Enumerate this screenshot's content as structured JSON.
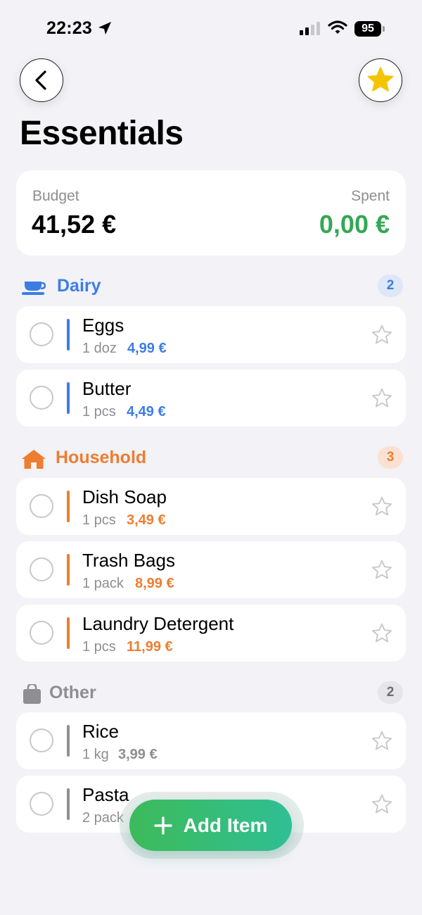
{
  "status_bar": {
    "time": "22:23",
    "battery": "95"
  },
  "header": {
    "title": "Essentials"
  },
  "budget": {
    "budget_label": "Budget",
    "budget_value": "41,52 €",
    "spent_label": "Spent",
    "spent_value": "0,00 €"
  },
  "colors": {
    "dairy": "#3d7de3",
    "household": "#ee7d2f",
    "other": "#8e8e93",
    "spent": "#34a853",
    "accent_gradient": [
      "#3dba5a",
      "#2fbf94"
    ]
  },
  "sections": [
    {
      "title": "Dairy",
      "count": "2",
      "icon": "cup-icon",
      "items": [
        {
          "name": "Eggs",
          "qty": "1 doz",
          "price": "4,99 €"
        },
        {
          "name": "Butter",
          "qty": "1 pcs",
          "price": "4,49 €"
        }
      ]
    },
    {
      "title": "Household",
      "count": "3",
      "icon": "house-icon",
      "items": [
        {
          "name": "Dish Soap",
          "qty": "1 pcs",
          "price": "3,49 €"
        },
        {
          "name": "Trash Bags",
          "qty": "1 pack",
          "price": "8,99 €"
        },
        {
          "name": "Laundry Detergent",
          "qty": "1 pcs",
          "price": "11,99 €"
        }
      ]
    },
    {
      "title": "Other",
      "count": "2",
      "icon": "bag-icon",
      "items": [
        {
          "name": "Rice",
          "qty": "1 kg",
          "price": "3,99 €"
        },
        {
          "name": "Pasta",
          "qty": "2 pack",
          "price": ""
        }
      ]
    }
  ],
  "add_button": {
    "label": "Add Item"
  }
}
